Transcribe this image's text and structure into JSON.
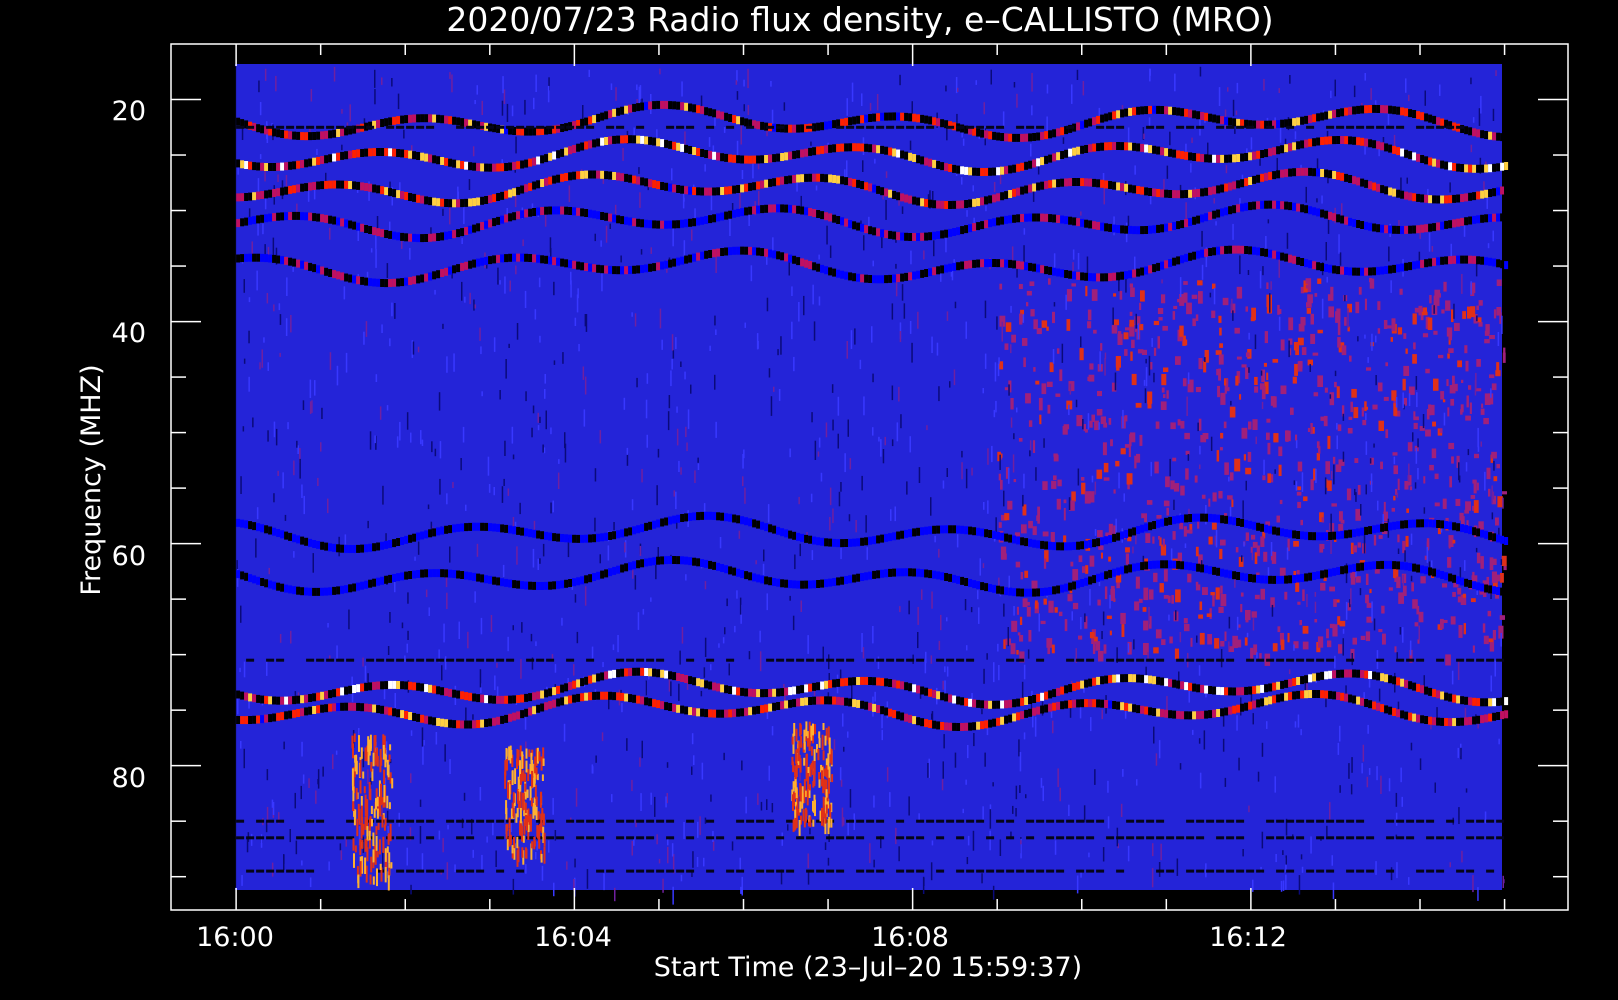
{
  "chart_data": {
    "type": "heatmap",
    "title": "2020/07/23  Radio flux density, e–CALLISTO (MRO)",
    "xlabel": "Start Time (23–Jul–20 15:59:37)",
    "ylabel": "Frequency (MHZ)",
    "x_range_minutes_after_1600": [
      -0.77,
      15.75
    ],
    "data_x_range_minutes_after_1600": [
      0,
      15.0
    ],
    "ylim": [
      15,
      93
    ],
    "data_y_range_mhz": [
      17,
      91
    ],
    "y_inverted": true,
    "x_ticks": [
      "16:00",
      "16:04",
      "16:08",
      "16:12"
    ],
    "y_ticks": [
      "20",
      "40",
      "60",
      "80"
    ],
    "colormap": [
      "#000000",
      "#0000ff",
      "#c01060",
      "#ff2000",
      "#ffd040",
      "#ffffff"
    ],
    "background_color": "#2424d8",
    "emission_bands": [
      {
        "freq_mhz": 22,
        "intensity": 0.85
      },
      {
        "freq_mhz": 25,
        "intensity": 1.0
      },
      {
        "freq_mhz": 28,
        "intensity": 0.9
      },
      {
        "freq_mhz": 31,
        "intensity": 0.6
      },
      {
        "freq_mhz": 35,
        "intensity": 0.6
      },
      {
        "freq_mhz": 59,
        "intensity": 0.35
      },
      {
        "freq_mhz": 63,
        "intensity": 0.3
      },
      {
        "freq_mhz": 73,
        "intensity": 1.0
      },
      {
        "freq_mhz": 75,
        "intensity": 0.9
      }
    ],
    "dark_lines_mhz": [
      22.5,
      70.5,
      85,
      86.5,
      89.5
    ],
    "reddish_region": {
      "x_minutes": [
        9,
        15
      ],
      "freq_mhz": [
        36,
        70
      ]
    },
    "bursts": [
      {
        "x_minutes": 1.6,
        "freq_mhz": [
          77,
          90
        ]
      },
      {
        "x_minutes": 6.8,
        "freq_mhz": [
          76,
          85
        ]
      },
      {
        "x_minutes": 3.4,
        "freq_mhz": [
          78,
          88
        ]
      }
    ]
  }
}
